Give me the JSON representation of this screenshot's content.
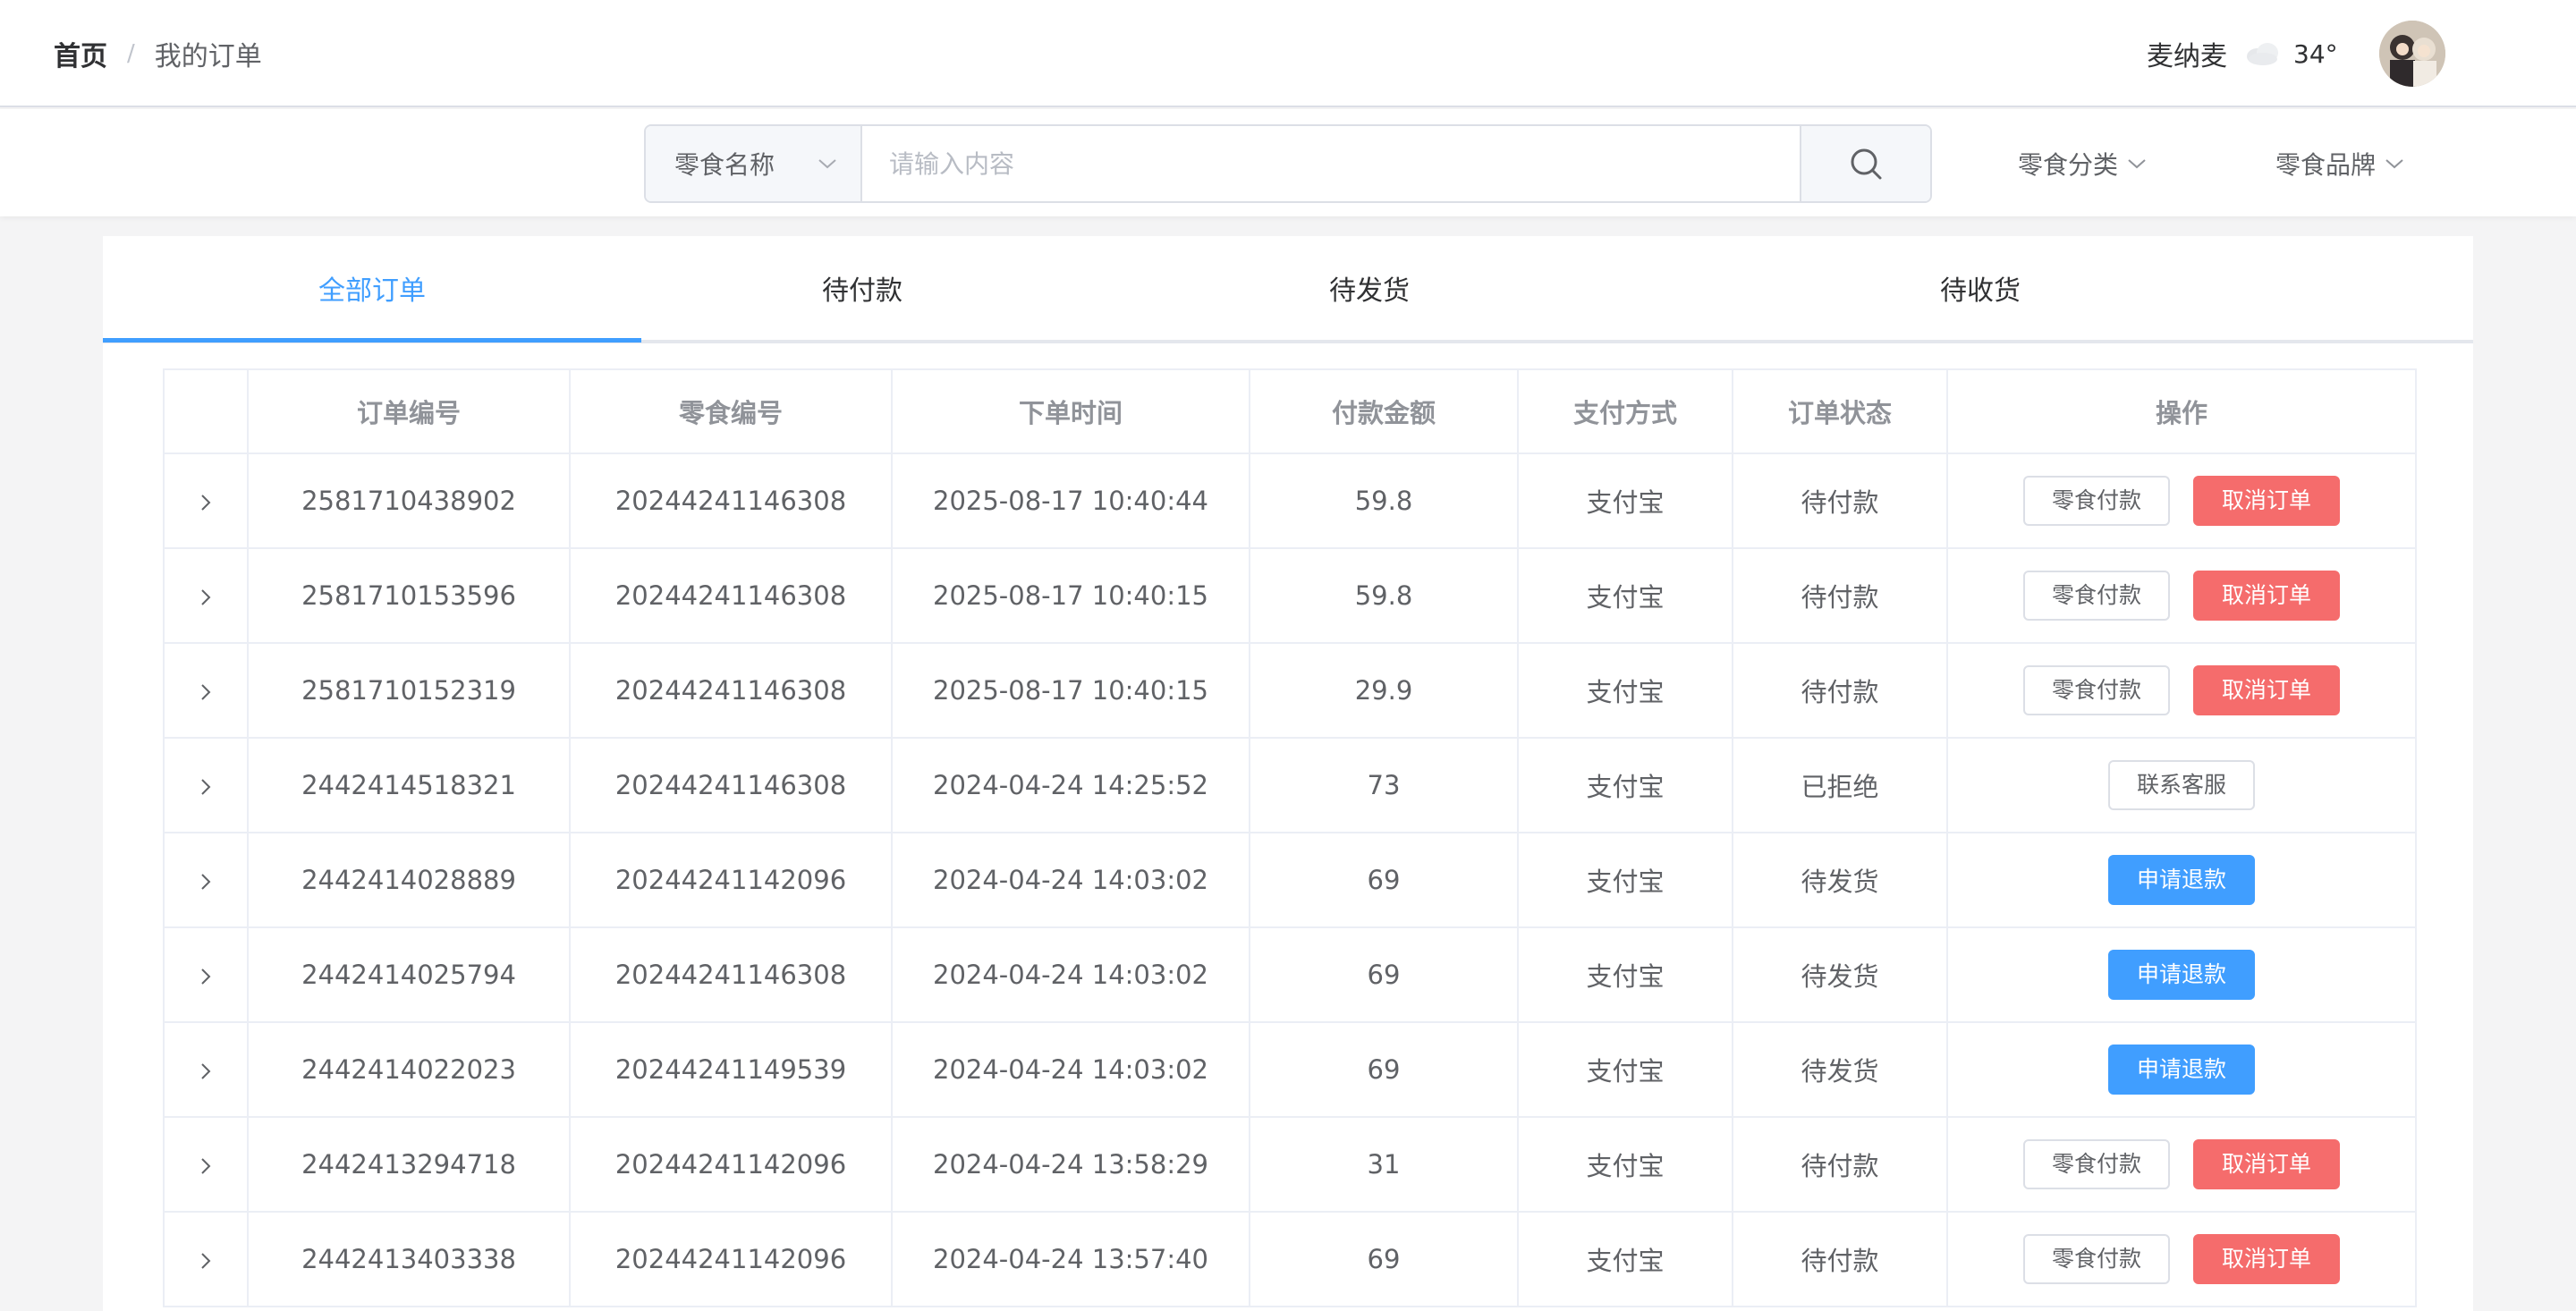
{
  "breadcrumb": {
    "home": "首页",
    "separator": "/",
    "current": "我的订单"
  },
  "user": {
    "name": "麦纳麦",
    "temperature": "34°",
    "weather_icon": "cloud-icon"
  },
  "search": {
    "select_label": "零食名称",
    "placeholder": "请输入内容",
    "filter_category": "零食分类",
    "filter_brand": "零食品牌"
  },
  "tabs": [
    {
      "label": "全部订单",
      "active": true
    },
    {
      "label": "待付款",
      "active": false
    },
    {
      "label": "待发货",
      "active": false
    },
    {
      "label": "待收货",
      "active": false
    }
  ],
  "table": {
    "headers": [
      "订单编号",
      "零食编号",
      "下单时间",
      "付款金额",
      "支付方式",
      "订单状态",
      "操作"
    ],
    "rows": [
      {
        "order_no": "2581710438902",
        "snack_no": "20244241146308",
        "time": "2025-08-17 10:40:44",
        "amount": "59.8",
        "pay": "支付宝",
        "status": "待付款",
        "actions": [
          "零食付款",
          "取消订单"
        ]
      },
      {
        "order_no": "2581710153596",
        "snack_no": "20244241146308",
        "time": "2025-08-17 10:40:15",
        "amount": "59.8",
        "pay": "支付宝",
        "status": "待付款",
        "actions": [
          "零食付款",
          "取消订单"
        ]
      },
      {
        "order_no": "2581710152319",
        "snack_no": "20244241146308",
        "time": "2025-08-17 10:40:15",
        "amount": "29.9",
        "pay": "支付宝",
        "status": "待付款",
        "actions": [
          "零食付款",
          "取消订单"
        ]
      },
      {
        "order_no": "2442414518321",
        "snack_no": "20244241146308",
        "time": "2024-04-24 14:25:52",
        "amount": "73",
        "pay": "支付宝",
        "status": "已拒绝",
        "actions": [
          "联系客服"
        ]
      },
      {
        "order_no": "2442414028889",
        "snack_no": "20244241142096",
        "time": "2024-04-24 14:03:02",
        "amount": "69",
        "pay": "支付宝",
        "status": "待发货",
        "actions": [
          "申请退款"
        ]
      },
      {
        "order_no": "2442414025794",
        "snack_no": "20244241146308",
        "time": "2024-04-24 14:03:02",
        "amount": "69",
        "pay": "支付宝",
        "status": "待发货",
        "actions": [
          "申请退款"
        ]
      },
      {
        "order_no": "2442414022023",
        "snack_no": "20244241149539",
        "time": "2024-04-24 14:03:02",
        "amount": "69",
        "pay": "支付宝",
        "status": "待发货",
        "actions": [
          "申请退款"
        ]
      },
      {
        "order_no": "2442413294718",
        "snack_no": "20244241142096",
        "time": "2024-04-24 13:58:29",
        "amount": "31",
        "pay": "支付宝",
        "status": "待付款",
        "actions": [
          "零食付款",
          "取消订单"
        ]
      },
      {
        "order_no": "2442413403338",
        "snack_no": "20244241142096",
        "time": "2024-04-24 13:57:40",
        "amount": "69",
        "pay": "支付宝",
        "status": "待付款",
        "actions": [
          "零食付款",
          "取消订单"
        ]
      }
    ]
  },
  "colors": {
    "primary": "#409eff",
    "danger": "#f56c6c",
    "border": "#ebeef5"
  }
}
